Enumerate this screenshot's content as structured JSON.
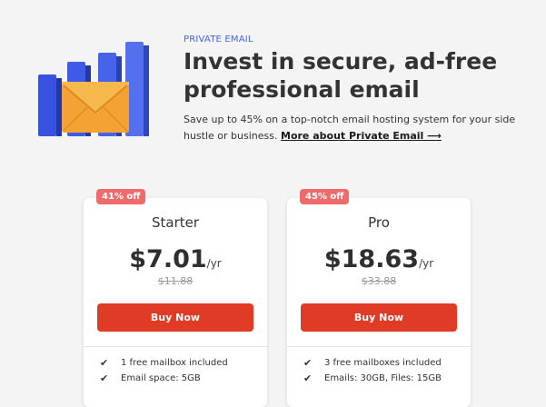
{
  "hero": {
    "eyebrow": "PRIVATE EMAIL",
    "title": "Invest in secure, ad-free professional email",
    "subtitle": "Save up to 45% on a top-notch email hosting system for your side hustle or business.",
    "link_label": "More about Private Email ⟶"
  },
  "plans": [
    {
      "badge": "41% off",
      "name": "Starter",
      "price": "$7.01",
      "period": "/yr",
      "old_price": "$11.88",
      "button_label": "Buy Now",
      "features": [
        "1 free mailbox included",
        "Email space: 5GB"
      ]
    },
    {
      "badge": "45% off",
      "name": "Pro",
      "price": "$18.63",
      "period": "/yr",
      "old_price": "$33.88",
      "button_label": "Buy Now",
      "features": [
        "3 free mailboxes included",
        "Emails: 30GB, Files: 15GB"
      ]
    }
  ],
  "icons": {
    "check": "check-icon",
    "illustration": "email-chart-illustration"
  },
  "colors": {
    "accent_blue": "#3f64e6",
    "button_red": "#e03b24",
    "badge_red": "#f16a6a",
    "envelope_orange": "#f3a233"
  }
}
